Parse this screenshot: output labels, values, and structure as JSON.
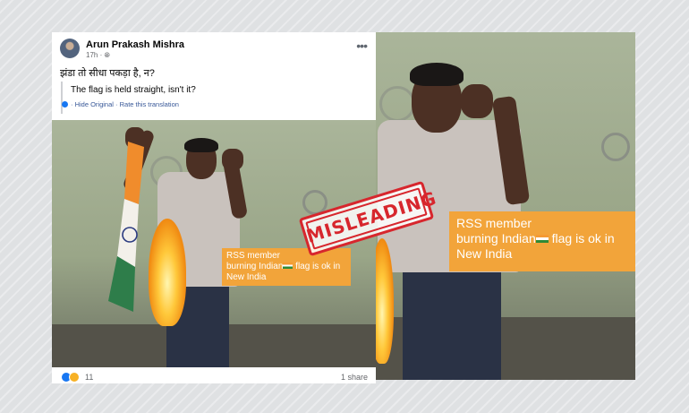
{
  "post": {
    "author": "Arun Prakash Mishra",
    "time": "17h",
    "privacy_icon": "globe-icon",
    "more_icon": "more-options-icon",
    "hindi_text": "झंडा तो सीधा पकड़ा है, न?",
    "translation": "The flag is held straight, isn't it?",
    "hide_original": "Hide Original",
    "rate_translation": "Rate this translation",
    "reaction_count": "11",
    "shares": "1 share"
  },
  "overlay_left": {
    "line1": "RSS member",
    "line2": "burning Indian",
    "line2b": " flag is ok in",
    "line3": "New India"
  },
  "overlay_right": {
    "line1": "RSS member",
    "line2": "burning Indian",
    "line2b": " flag is ok in",
    "line3": "New India"
  },
  "stamp": {
    "label": "MISLEADING",
    "color": "#d7262d"
  },
  "colors": {
    "facebook_blue": "#1877f2",
    "overlay_orange": "#f2a43a",
    "link_blue": "#385898"
  }
}
